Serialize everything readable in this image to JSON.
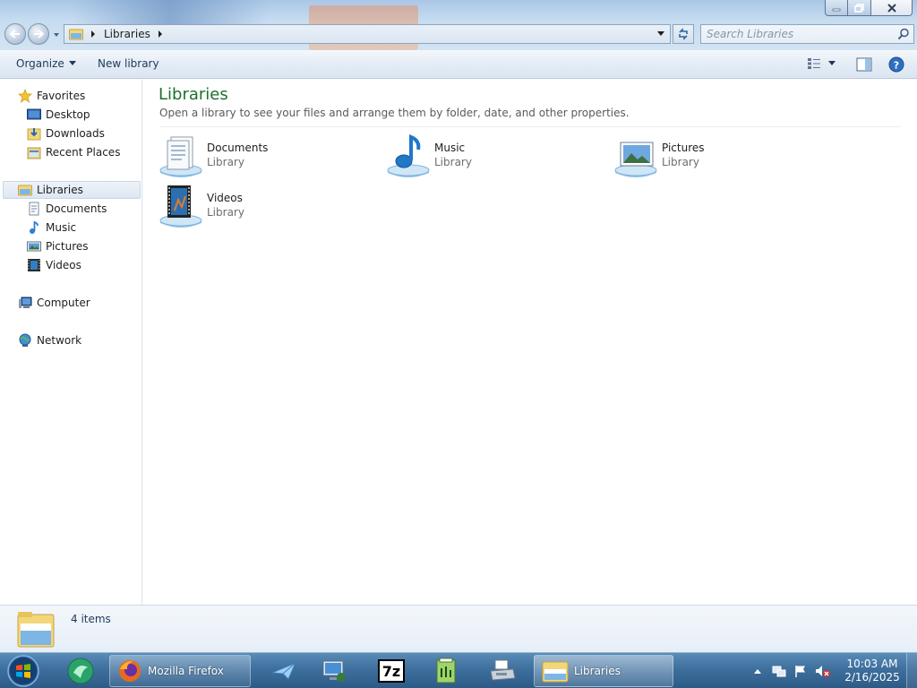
{
  "window": {
    "controls": {
      "minimize": "minimize",
      "maximize": "maximize",
      "close": "close"
    }
  },
  "address": {
    "path": "Libraries",
    "search_placeholder": "Search Libraries"
  },
  "toolbar": {
    "organize_label": "Organize",
    "new_library_label": "New library"
  },
  "nav_pane": {
    "favorites": {
      "label": "Favorites",
      "items": [
        {
          "label": "Desktop",
          "icon": "desktop-icon"
        },
        {
          "label": "Downloads",
          "icon": "downloads-icon"
        },
        {
          "label": "Recent Places",
          "icon": "recent-places-icon"
        }
      ]
    },
    "libraries": {
      "label": "Libraries",
      "selected": true,
      "items": [
        {
          "label": "Documents",
          "icon": "documents-icon"
        },
        {
          "label": "Music",
          "icon": "music-icon"
        },
        {
          "label": "Pictures",
          "icon": "pictures-icon"
        },
        {
          "label": "Videos",
          "icon": "videos-icon"
        }
      ]
    },
    "computer": {
      "label": "Computer"
    },
    "network": {
      "label": "Network"
    }
  },
  "content": {
    "title": "Libraries",
    "subtitle": "Open a library to see your files and arrange them by folder, date, and other properties.",
    "libraries": [
      {
        "name": "Documents",
        "type": "Library",
        "icon": "documents-library-icon"
      },
      {
        "name": "Music",
        "type": "Library",
        "icon": "music-library-icon"
      },
      {
        "name": "Pictures",
        "type": "Library",
        "icon": "pictures-library-icon"
      },
      {
        "name": "Videos",
        "type": "Library",
        "icon": "videos-library-icon"
      }
    ]
  },
  "details": {
    "item_count": "4 items"
  },
  "taskbar": {
    "apps": [
      {
        "label": "",
        "icon": "start-orb-icon"
      },
      {
        "label": "",
        "icon": "green-app-icon"
      },
      {
        "label": "Mozilla Firefox",
        "icon": "firefox-icon"
      },
      {
        "label": "",
        "icon": "paper-plane-icon"
      },
      {
        "label": "",
        "icon": "remote-desktop-icon"
      },
      {
        "label": "",
        "icon": "7zip-icon"
      },
      {
        "label": "",
        "icon": "notepad-plus-icon"
      },
      {
        "label": "",
        "icon": "printer-fax-icon"
      },
      {
        "label": "Libraries",
        "icon": "libraries-folder-icon"
      }
    ],
    "clock": {
      "time": "10:03 AM",
      "date": "2/16/2025"
    }
  },
  "colors": {
    "content_title": "#1e6f2d",
    "taskbar_base": "#2d5b87",
    "toolbar_text": "#1e395b"
  }
}
